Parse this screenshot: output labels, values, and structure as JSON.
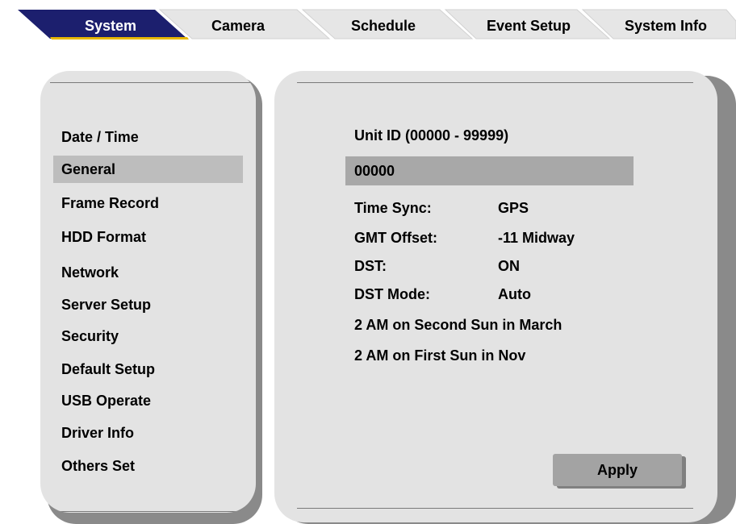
{
  "tabs": [
    {
      "label": "System",
      "active": true
    },
    {
      "label": "Camera",
      "active": false
    },
    {
      "label": "Schedule",
      "active": false
    },
    {
      "label": "Event Setup",
      "active": false
    },
    {
      "label": "System Info",
      "active": false
    }
  ],
  "sidebar": {
    "items": [
      {
        "label": "Date / Time"
      },
      {
        "label": "General",
        "selected": true
      },
      {
        "label": "Frame Record"
      },
      {
        "label": "HDD Format"
      },
      {
        "label": "Network"
      },
      {
        "label": "Server Setup"
      },
      {
        "label": "Security"
      },
      {
        "label": "Default Setup"
      },
      {
        "label": "USB Operate"
      },
      {
        "label": "Driver Info"
      },
      {
        "label": "Others Set"
      }
    ]
  },
  "main": {
    "unit_id_label": "Unit ID (00000 - 99999)",
    "unit_id_value": "00000",
    "fields": [
      {
        "label": "Time Sync:",
        "value": "GPS"
      },
      {
        "label": "GMT Offset:",
        "value": "-11 Midway"
      },
      {
        "label": "DST:",
        "value": "ON"
      },
      {
        "label": "DST Mode:",
        "value": "Auto"
      }
    ],
    "dst_start": "2 AM on Second Sun in March",
    "dst_end": "2 AM on First Sun in Nov",
    "apply_label": "Apply"
  },
  "colors": {
    "active_tab": "#1c1f6e",
    "active_tab_accent": "#e8b800",
    "inactive_tab": "#e6e6e6",
    "panel": "#e3e3e3",
    "selected_item": "#bdbdbd",
    "input_bg": "#a8a8a8",
    "button_bg": "#a3a3a3"
  }
}
